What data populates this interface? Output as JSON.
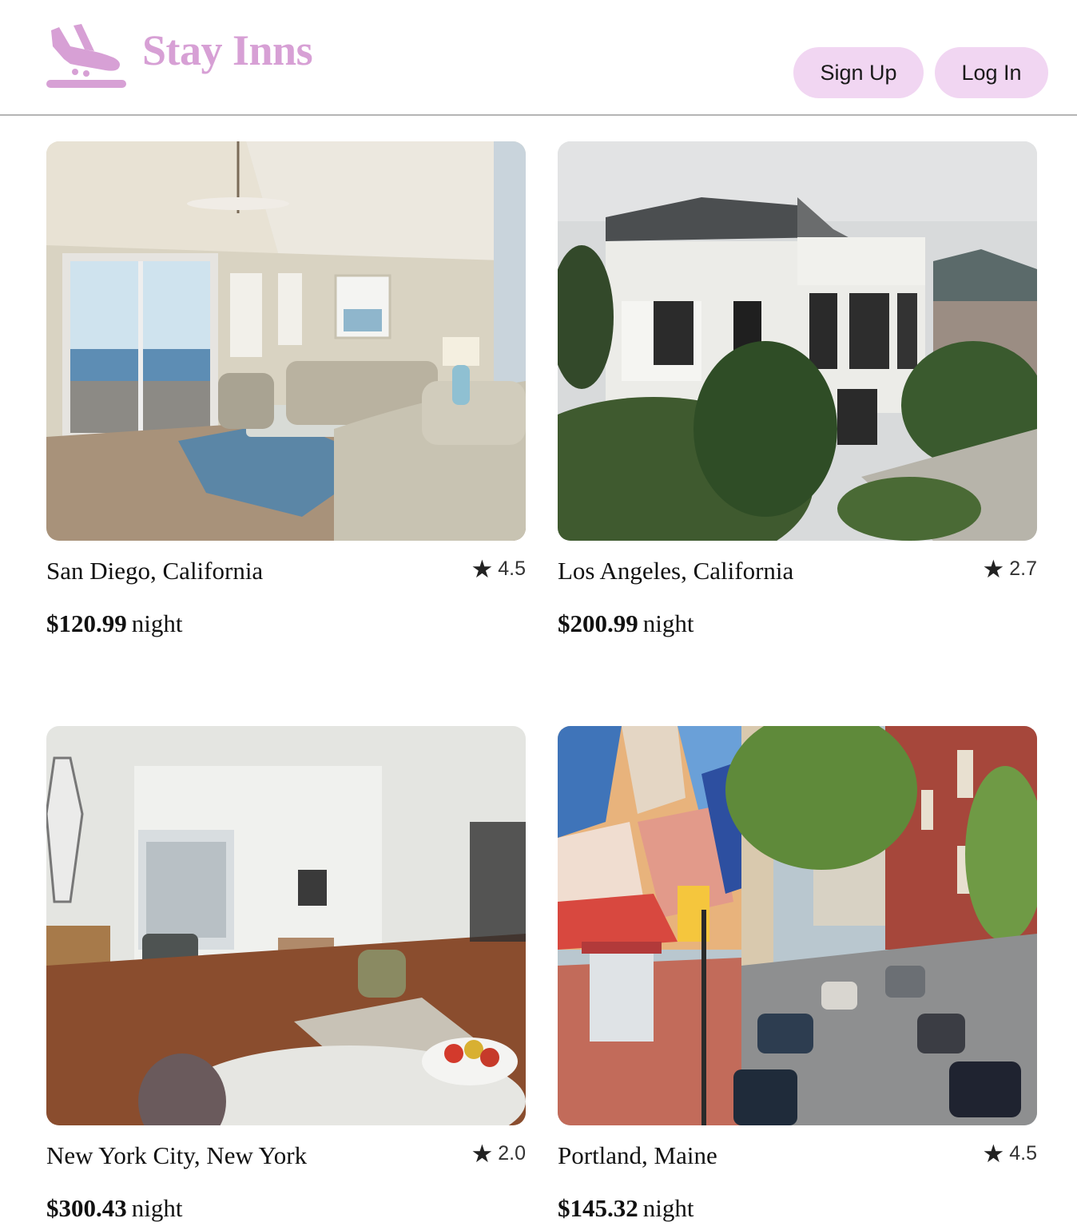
{
  "app": {
    "brand_name": "Stay Inns",
    "brand_icon": "airplane-landing-icon",
    "brand_color": "#d7a0d5"
  },
  "header": {
    "signup_label": "Sign Up",
    "login_label": "Log In",
    "button_color": "#f1d6f2"
  },
  "listings": [
    {
      "location": "San Diego, California",
      "rating": "4.5",
      "price": "$120.99",
      "unit": "night",
      "photo": "beach-condo-living-room"
    },
    {
      "location": "Los Angeles, California",
      "rating": "2.7",
      "price": "$200.99",
      "unit": "night",
      "photo": "white-bungalow-exterior"
    },
    {
      "location": "New York City, New York",
      "rating": "2.0",
      "price": "$300.43",
      "unit": "night",
      "photo": "apartment-living-room"
    },
    {
      "location": "Portland, Maine",
      "rating": "4.5",
      "price": "$145.32",
      "unit": "night",
      "photo": "city-street-mural"
    }
  ]
}
